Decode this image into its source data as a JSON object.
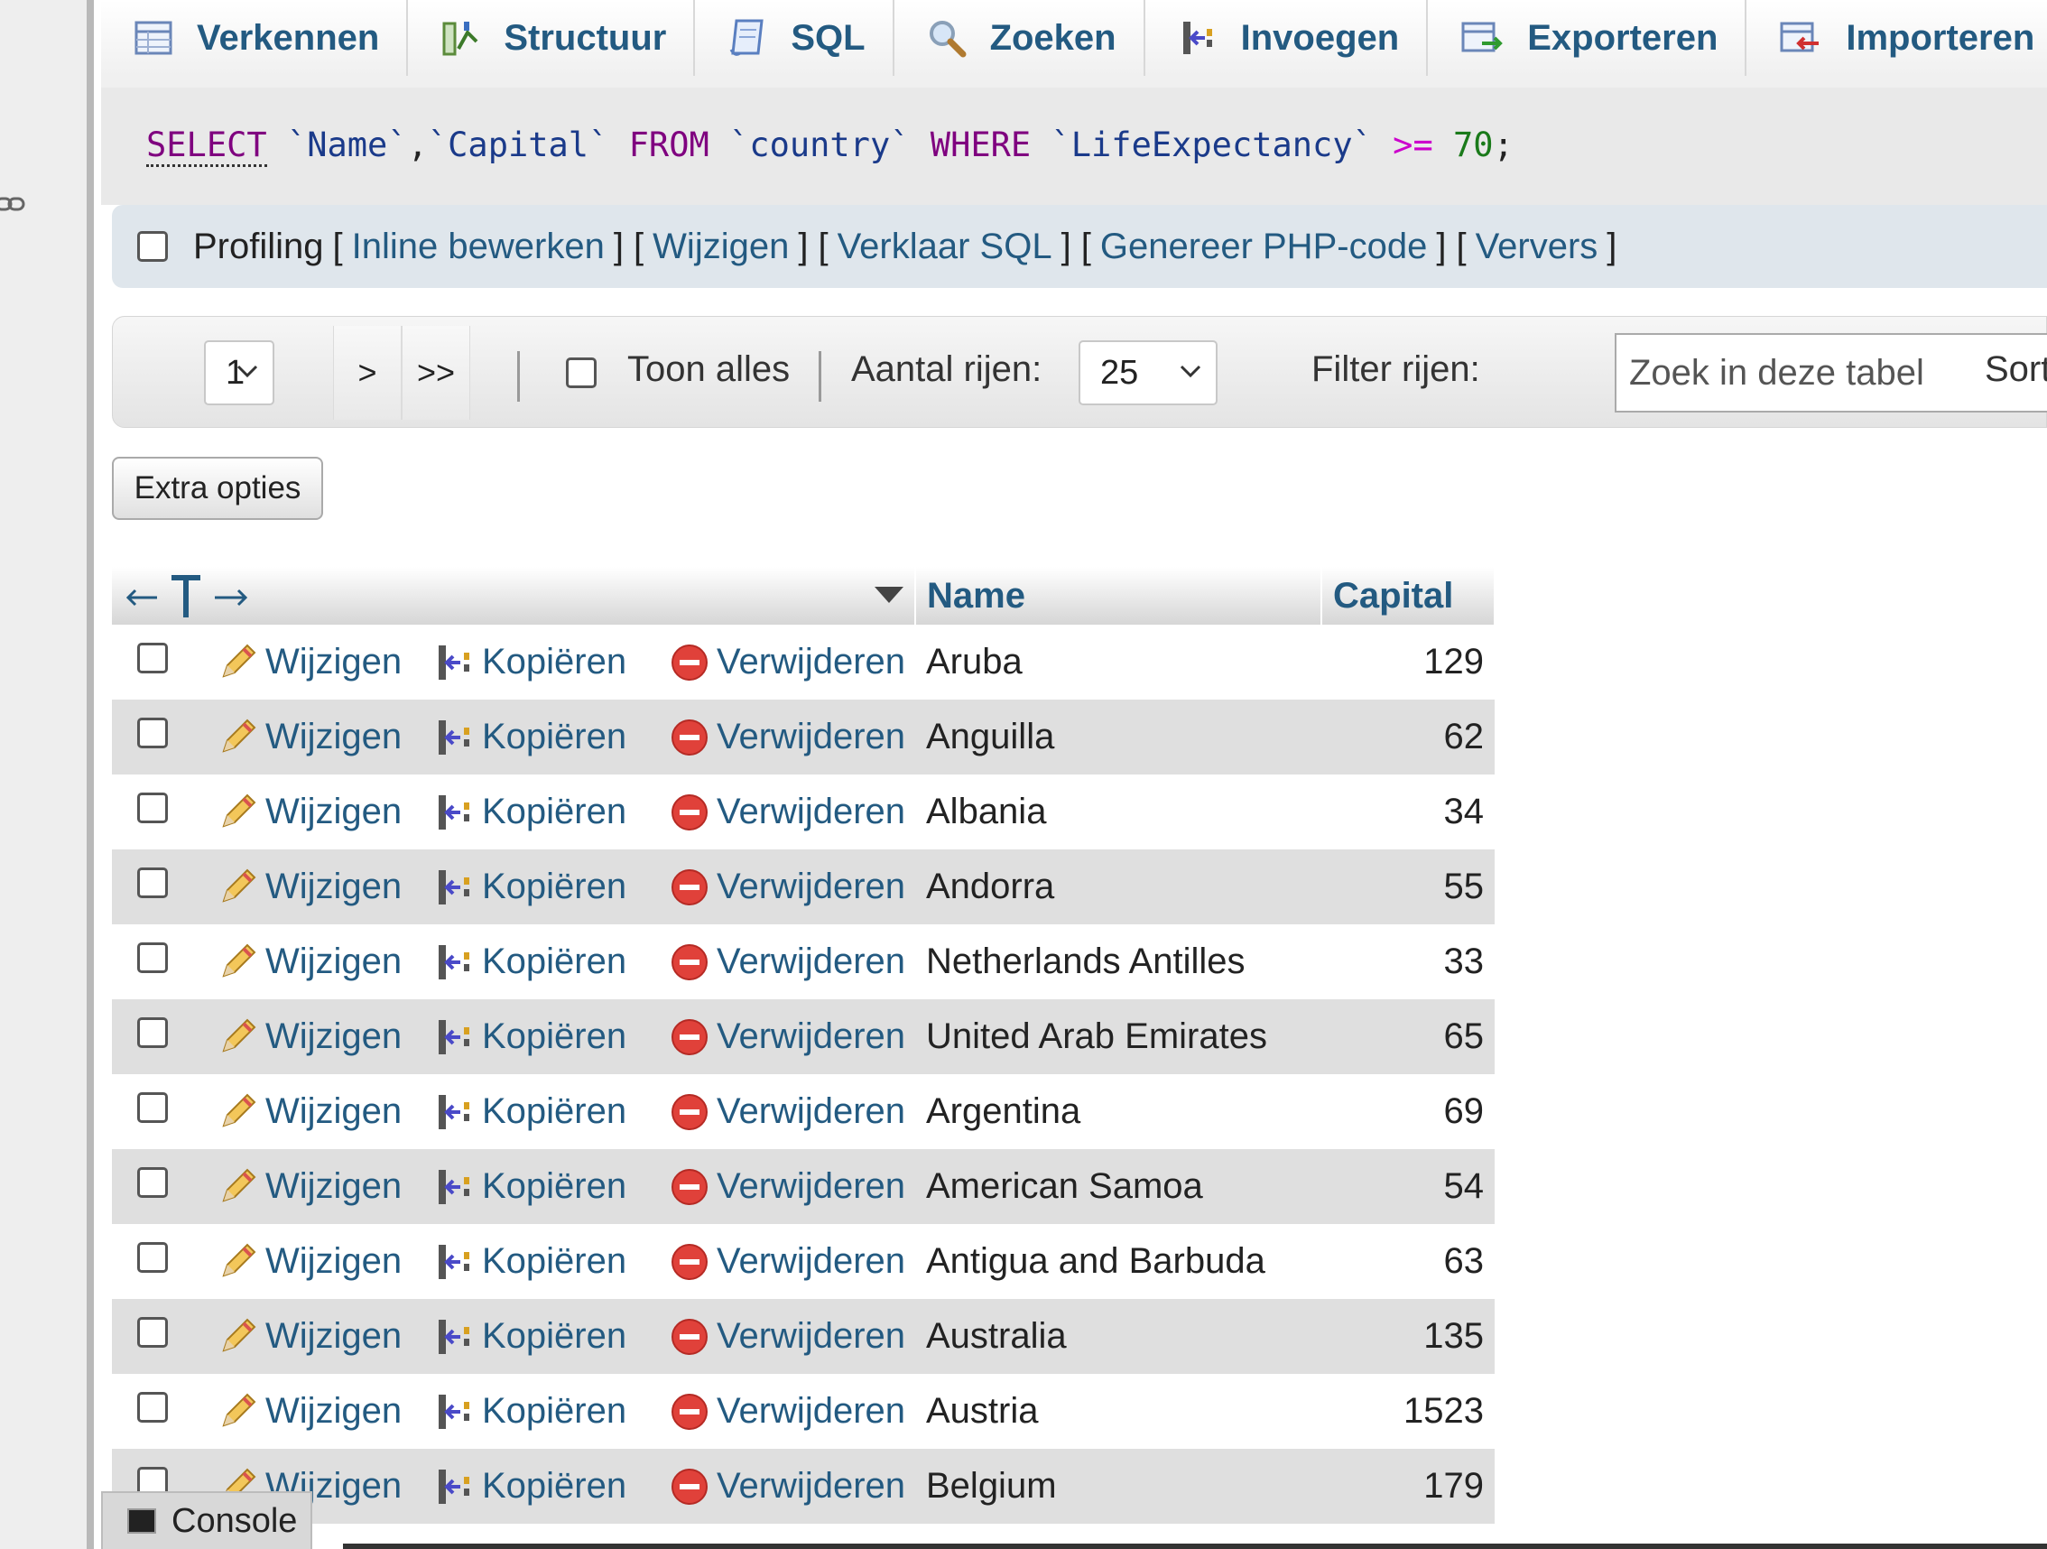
{
  "tabs": [
    {
      "label": "Verkennen",
      "icon": "browse-icon"
    },
    {
      "label": "Structuur",
      "icon": "structure-icon"
    },
    {
      "label": "SQL",
      "icon": "sql-icon"
    },
    {
      "label": "Zoeken",
      "icon": "search-icon"
    },
    {
      "label": "Invoegen",
      "icon": "insert-icon"
    },
    {
      "label": "Exporteren",
      "icon": "export-icon"
    },
    {
      "label": "Importeren",
      "icon": "import-icon"
    }
  ],
  "sql": {
    "select": "SELECT",
    "col1": "`Name`",
    "comma": ",",
    "col2": "`Capital`",
    "from": "FROM",
    "table": "`country`",
    "where": "WHERE",
    "cond_col": "`LifeExpectancy`",
    "op": ">=",
    "value": "70",
    "end": ";"
  },
  "tools": {
    "profiling": "Profiling",
    "inline_edit": "Inline bewerken",
    "edit": "Wijzigen",
    "explain": "Verklaar SQL",
    "php": "Genereer PHP-code",
    "refresh": "Ververs"
  },
  "nav": {
    "page": "1",
    "next": ">",
    "last": ">>",
    "show_all": "Toon alles",
    "rows_label": "Aantal rijen:",
    "rows_value": "25",
    "filter_label": "Filter rijen:",
    "filter_placeholder": "Zoek in deze tabel",
    "sort_label": "Sort"
  },
  "extra_options": "Extra opties",
  "table": {
    "columns": [
      "Name",
      "Capital"
    ],
    "actions": {
      "edit": "Wijzigen",
      "copy": "Kopiëren",
      "delete": "Verwijderen"
    },
    "rows": [
      {
        "name": "Aruba",
        "capital": "129"
      },
      {
        "name": "Anguilla",
        "capital": "62"
      },
      {
        "name": "Albania",
        "capital": "34"
      },
      {
        "name": "Andorra",
        "capital": "55"
      },
      {
        "name": "Netherlands Antilles",
        "capital": "33"
      },
      {
        "name": "United Arab Emirates",
        "capital": "65"
      },
      {
        "name": "Argentina",
        "capital": "69"
      },
      {
        "name": "American Samoa",
        "capital": "54"
      },
      {
        "name": "Antigua and Barbuda",
        "capital": "63"
      },
      {
        "name": "Australia",
        "capital": "135"
      },
      {
        "name": "Austria",
        "capital": "1523"
      },
      {
        "name": "Belgium",
        "capital": "179"
      }
    ]
  },
  "console": "Console",
  "colors": {
    "link": "#235a81",
    "row_alt": "#dfdfdf",
    "delete": "#e0413a"
  }
}
